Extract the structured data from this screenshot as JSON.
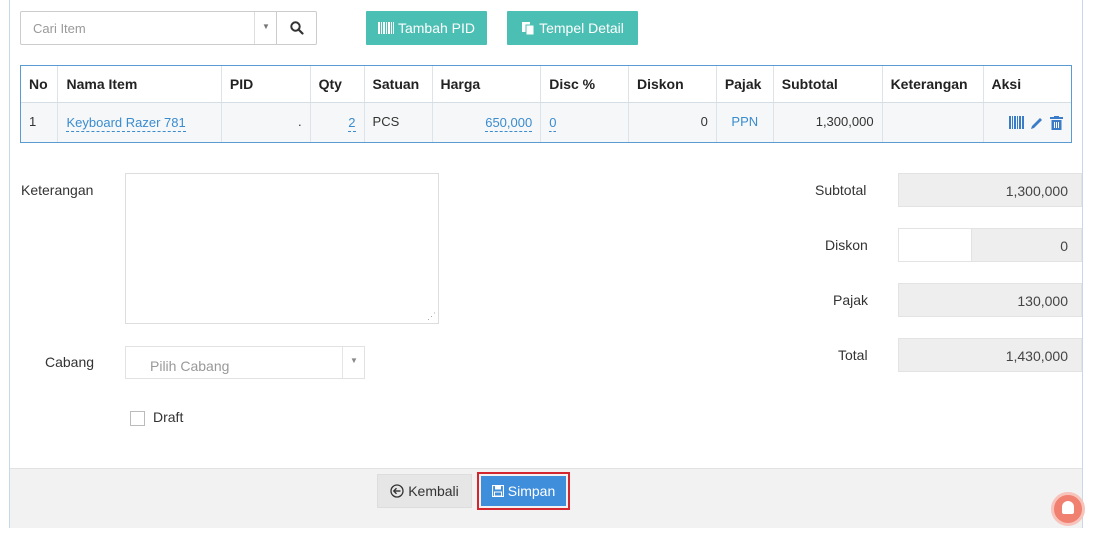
{
  "toolbar": {
    "search_placeholder": "Cari Item",
    "tambah_pid_label": "Tambah PID",
    "tempel_detail_label": "Tempel Detail"
  },
  "table": {
    "headers": [
      "No",
      "Nama Item",
      "PID",
      "Qty",
      "Satuan",
      "Harga",
      "Disc %",
      "Diskon",
      "Pajak",
      "Subtotal",
      "Keterangan",
      "Aksi"
    ],
    "rows": [
      {
        "no": "1",
        "nama_item": "Keyboard Razer 781",
        "pid": ".",
        "qty": "2",
        "satuan": "PCS",
        "harga": "650,000",
        "disc_pct": "0",
        "diskon": "0",
        "pajak": "PPN",
        "subtotal": "1,300,000",
        "keterangan": ""
      }
    ]
  },
  "form": {
    "keterangan_label": "Keterangan",
    "cabang_label": "Cabang",
    "cabang_placeholder": "Pilih Cabang",
    "draft_label": "Draft"
  },
  "summary": {
    "subtotal_label": "Subtotal",
    "subtotal_value": "1,300,000",
    "diskon_label": "Diskon",
    "diskon_value": "0",
    "pajak_label": "Pajak",
    "pajak_value": "130,000",
    "total_label": "Total",
    "total_value": "1,430,000"
  },
  "footer": {
    "kembali_label": "Kembali",
    "simpan_label": "Simpan"
  },
  "colors": {
    "teal_button": "#4bbfb3",
    "primary_button": "#3e8edb",
    "highlight_border": "#d4262e",
    "link": "#3a8ccf"
  }
}
